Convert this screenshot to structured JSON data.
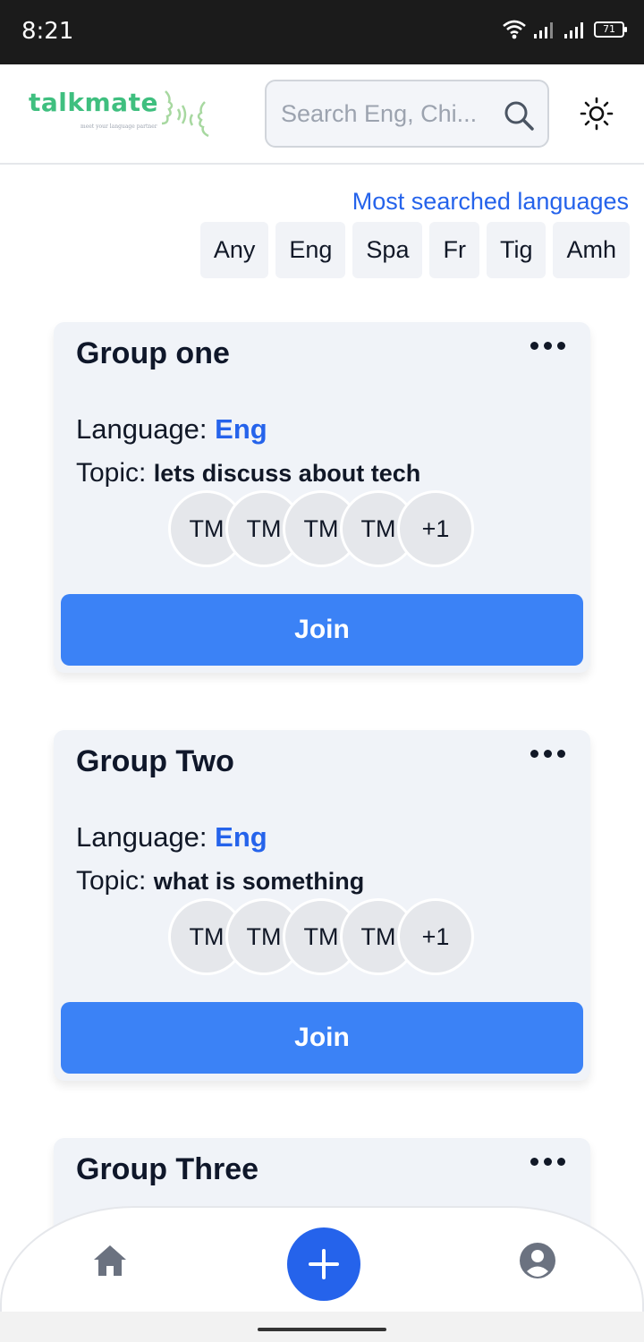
{
  "status_bar": {
    "time": "8:21",
    "battery": "71"
  },
  "header": {
    "logo_text": "talkmate",
    "logo_tagline": "meet your language partner",
    "search_placeholder": "Search Eng, Chi..."
  },
  "languages": {
    "title": "Most searched languages",
    "chips": [
      "Any",
      "Eng",
      "Spa",
      "Fr",
      "Tig",
      "Amh"
    ]
  },
  "groups": [
    {
      "title": "Group one",
      "language_label": "Language: ",
      "language": "Eng",
      "topic_label": "Topic: ",
      "topic": "lets discuss about tech",
      "avatars": [
        "TM",
        "TM",
        "TM",
        "TM",
        "+1"
      ],
      "join_label": "Join"
    },
    {
      "title": "Group Two",
      "language_label": "Language: ",
      "language": "Eng",
      "topic_label": "Topic: ",
      "topic": "what is something",
      "avatars": [
        "TM",
        "TM",
        "TM",
        "TM",
        "+1"
      ],
      "join_label": "Join"
    },
    {
      "title": "Group Three"
    }
  ],
  "bottom_nav": {
    "items": [
      "home-icon",
      "plus-icon",
      "user-circle-icon"
    ],
    "accent": "#2563eb"
  },
  "colors": {
    "accent": "#3b82f6",
    "link": "#2563eb",
    "brand": "#3fbf7f",
    "card_bg": "#f0f3f8"
  }
}
